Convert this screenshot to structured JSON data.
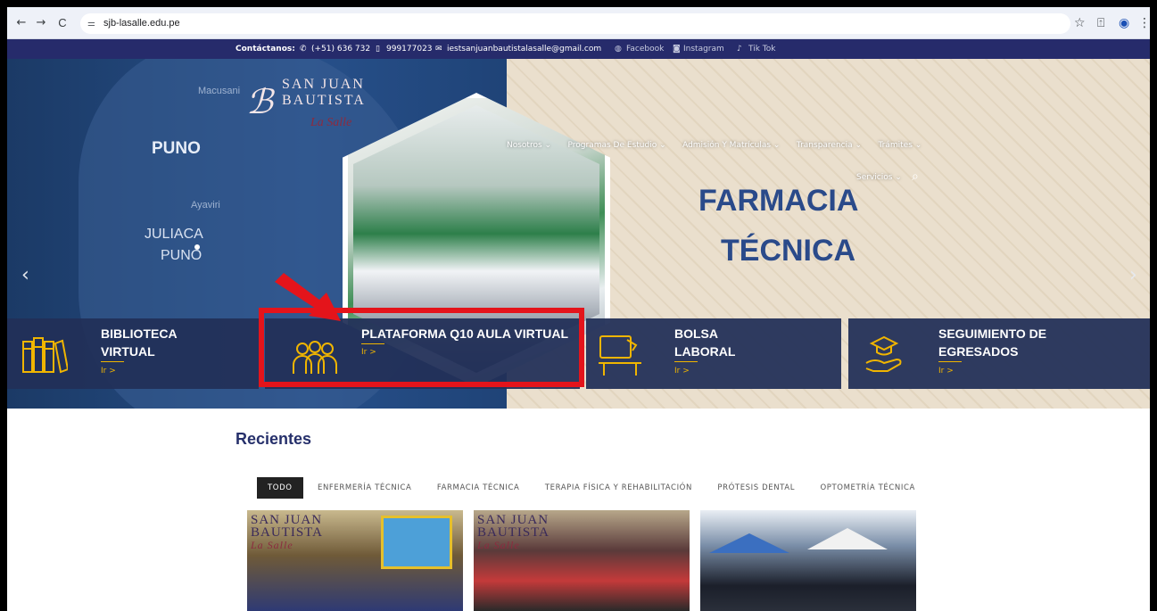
{
  "browser": {
    "nav_back": "←",
    "nav_forward": "→",
    "nav_reload": "C",
    "url": "sjb-lasalle.edu.pe",
    "star_icon": "☆",
    "ext_icon": "⍐",
    "profile_icon": "◉",
    "menu_icon": "⋮"
  },
  "contact": {
    "label": "Contáctanos:",
    "phone": "(+51) 636 732",
    "mobile": "999177023",
    "email": "iestsanjuanbautistalasalle@gmail.com",
    "facebook": "Facebook",
    "instagram": "Instagram",
    "tiktok": "Tik Tok"
  },
  "logo": {
    "line1": "SAN JUAN",
    "line2": "BAUTISTA",
    "line3": "La Salle"
  },
  "nav": {
    "items": [
      "Nosotros ⌄",
      "Programas De Estudio ⌄",
      "Admisión Y Matrículas ⌄",
      "Transparencia ⌄",
      "Trámites ⌄"
    ],
    "servicios": "Servicios ⌄"
  },
  "map": {
    "macusani": "Macusani",
    "puno": "PUNO",
    "ayaviri": "Ayaviri",
    "juliaca": "JULIACA",
    "puno2": "PUNO"
  },
  "hero": {
    "title_line1": "FARMACIA",
    "title_line2": "TÉCNICA",
    "prev": "‹",
    "next": "›"
  },
  "quick_links": [
    {
      "title1": "BIBLIOTECA",
      "title2": "VIRTUAL",
      "cta": "Ir >"
    },
    {
      "title1": "PLATAFORMA Q10 AULA VIRTUAL",
      "title2": "",
      "cta": "Ir >"
    },
    {
      "title1": "BOLSA",
      "title2": "LABORAL",
      "cta": "Ir >"
    },
    {
      "title1": "SEGUIMIENTO DE",
      "title2": "EGRESADOS",
      "cta": "Ir >"
    }
  ],
  "recent": {
    "heading": "Recientes",
    "tabs": [
      "TODO",
      "ENFERMERÍA TÉCNICA",
      "FARMACIA TÉCNICA",
      "TERAPIA FÍSICA Y REHABILITACIÓN",
      "PRÓTESIS DENTAL",
      "OPTOMETRÍA TÉCNICA"
    ]
  },
  "colors": {
    "navy": "#262b6b",
    "gold": "#f0b500",
    "highlight": "#e4141b",
    "title_blue": "#2a4a8a"
  }
}
